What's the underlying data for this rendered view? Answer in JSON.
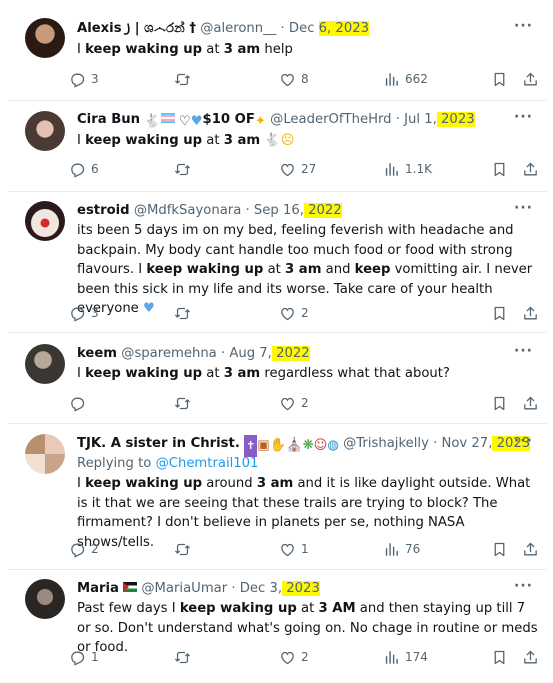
{
  "colors": {
    "highlight": "#fcf900",
    "link": "#1d9bf0",
    "muted": "#536471",
    "heart_emoji": "#5aa6e8"
  },
  "tweets": [
    {
      "name": "Alexis ꠸ | ශ෴රන් †",
      "handle": "@aleronn__",
      "date_prefix": "· Dec ",
      "date_hl": "6, 2023",
      "body": "I keep waking up at 3 am help",
      "replies": "3",
      "retweets": "",
      "likes": "8",
      "views": "662"
    },
    {
      "name": "Cira Bun",
      "badges": "$10 OF",
      "handle": "@LeaderOfTheHrd",
      "date_prefix": "· Jul 1,",
      "date_hl": " 2023",
      "body_pre": "I keep waking up at 3 am",
      "replies": "6",
      "likes": "27",
      "views": "1.1K"
    },
    {
      "name": "estroid",
      "handle": "@MdfkSayonara",
      "date_prefix": "· Sep 16,",
      "date_hl": " 2022",
      "body_1": "its been 5 days im on my bed, feeling feverish with headache and backpain. My body cant handle too much food or food with strong flavours. I",
      "body_2": "keep waking up",
      "body_3": "at",
      "body_4": "3 am",
      "body_5": "and",
      "body_6": "keep",
      "body_7": "vomitting air. I never been this sick in my life and its worse. Take care of your health everyone",
      "replies": "3",
      "likes": "2"
    },
    {
      "name": "keem",
      "handle": "@sparemehna",
      "date_prefix": "· Aug 7,",
      "date_hl": " 2022",
      "body_tail": "regardless what that about?",
      "likes": "2"
    },
    {
      "name": "TJK. A sister in Christ.",
      "handle": "@Trishajkelly",
      "date_prefix": "· Nov 27,",
      "date_hl": " 2023",
      "replying": "Replying to",
      "replying_to": "@Chemtrail101",
      "body_1": "keep waking up",
      "body_2": "around",
      "body_3": "3 am",
      "body_4": "and it is like daylight outside. What is it that we are seeing that these trails are trying to block? The firmament? I don't believe in planets per se, nothing NASA shows/tells.",
      "replies": "2",
      "likes": "1",
      "views": "76"
    },
    {
      "name": "Maria",
      "handle": "@MariaUmar",
      "date_prefix": "· Dec 3,",
      "date_hl": " 2023",
      "body_1": "Past few days I",
      "body_2": "keep waking up",
      "body_3": "at",
      "body_4": "3 AM",
      "body_5": "and then staying up till 7 or so. Don't understand what's going on. No chage in routine or meds or food.",
      "replies": "1",
      "likes": "2",
      "views": "174"
    }
  ],
  "common": {
    "I": "I",
    "keep_waking_up": "keep waking up",
    "at": "at",
    "three_am": "3 am",
    "more": "···"
  }
}
